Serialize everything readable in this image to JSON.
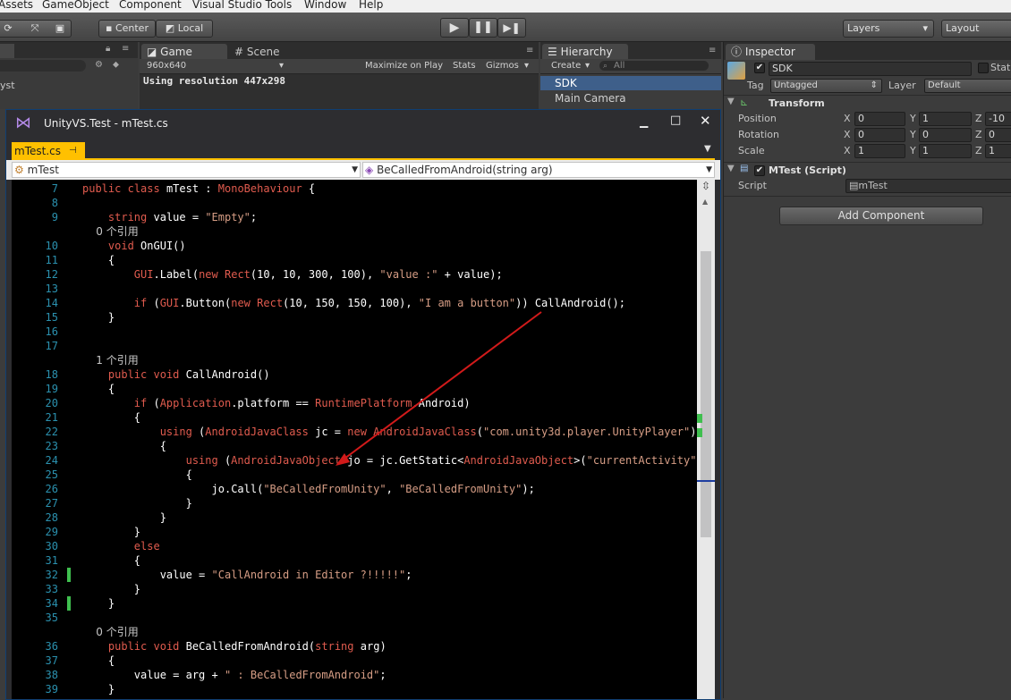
{
  "menu": {
    "items": [
      "Assets",
      "GameObject",
      "Component",
      "Visual Studio Tools",
      "Window",
      "Help"
    ]
  },
  "toolbar": {
    "center_label": "Center",
    "local_label": "Local",
    "layers_label": "Layers",
    "layout_label": "Layout"
  },
  "left_panel": {
    "partial_text": "yst"
  },
  "game_panel": {
    "tab_game": "Game",
    "tab_scene": "Scene",
    "resolution_select": "960x640",
    "maximize_label": "Maximize on Play",
    "stats_label": "Stats",
    "gizmos_label": "Gizmos",
    "resolution_text": "Using resolution 447x298"
  },
  "hierarchy": {
    "tab": "Hierarchy",
    "create_label": "Create",
    "search_placeholder": "All",
    "items": [
      "SDK",
      "Main Camera"
    ]
  },
  "inspector": {
    "tab": "Inspector",
    "object_name": "SDK",
    "static_label": "Stat",
    "tag_label": "Tag",
    "tag_value": "Untagged",
    "layer_label": "Layer",
    "layer_value": "Default",
    "transform_title": "Transform",
    "position_label": "Position",
    "rotation_label": "Rotation",
    "scale_label": "Scale",
    "position": {
      "x": "0",
      "y": "1",
      "z": "-10"
    },
    "rotation": {
      "x": "0",
      "y": "0",
      "z": "0"
    },
    "scale": {
      "x": "1",
      "y": "1",
      "z": "1"
    },
    "axis_x": "X",
    "axis_y": "Y",
    "axis_z": "Z",
    "script_component_title": "MTest (Script)",
    "script_label": "Script",
    "script_value": "mTest",
    "add_component_label": "Add Component"
  },
  "vs_window": {
    "title": "UnityVS.Test - mTest.cs",
    "file_tab": "mTest.cs",
    "pin_symbol": "⊣",
    "nav_class": "mTest",
    "nav_member": "BeCalledFromAndroid(string arg)"
  },
  "code_lines": [
    {
      "n": "7",
      "text": "public class mTest : MonoBehaviour {"
    },
    {
      "n": "8",
      "text": ""
    },
    {
      "n": "9",
      "text": "    string value = \"Empty\";"
    },
    {
      "n": "",
      "text": "    0 个引用"
    },
    {
      "n": "10",
      "text": "    void OnGUI()"
    },
    {
      "n": "11",
      "text": "    {"
    },
    {
      "n": "12",
      "text": "        GUI.Label(new Rect(10, 10, 300, 100), \"value :\" + value);"
    },
    {
      "n": "13",
      "text": ""
    },
    {
      "n": "14",
      "text": "        if (GUI.Button(new Rect(10, 150, 150, 100), \"I am a button\")) CallAndroid();"
    },
    {
      "n": "15",
      "text": "    }"
    },
    {
      "n": "16",
      "text": ""
    },
    {
      "n": "17",
      "text": ""
    },
    {
      "n": "",
      "text": "    1 个引用"
    },
    {
      "n": "18",
      "text": "    public void CallAndroid()"
    },
    {
      "n": "19",
      "text": "    {"
    },
    {
      "n": "20",
      "text": "        if (Application.platform == RuntimePlatform.Android)"
    },
    {
      "n": "21",
      "text": "        {"
    },
    {
      "n": "22",
      "text": "            using (AndroidJavaClass jc = new AndroidJavaClass(\"com.unity3d.player.UnityPlayer\"))"
    },
    {
      "n": "23",
      "text": "            {"
    },
    {
      "n": "24",
      "text": "                using (AndroidJavaObject jo = jc.GetStatic<AndroidJavaObject>(\"currentActivity\"))"
    },
    {
      "n": "25",
      "text": "                {"
    },
    {
      "n": "26",
      "text": "                    jo.Call(\"BeCalledFromUnity\", \"BeCalledFromUnity\");"
    },
    {
      "n": "27",
      "text": "                }"
    },
    {
      "n": "28",
      "text": "            }"
    },
    {
      "n": "29",
      "text": "        }"
    },
    {
      "n": "30",
      "text": "        else"
    },
    {
      "n": "31",
      "text": "        {"
    },
    {
      "n": "32",
      "text": "            value = \"CallAndroid in Editor ?!!!!!\";"
    },
    {
      "n": "33",
      "text": "        }"
    },
    {
      "n": "34",
      "text": "    }"
    },
    {
      "n": "35",
      "text": ""
    },
    {
      "n": "",
      "text": "    0 个引用"
    },
    {
      "n": "36",
      "text": "    public void BeCalledFromAndroid(string arg)"
    },
    {
      "n": "37",
      "text": "    {"
    },
    {
      "n": "38",
      "text": "        value = arg + \" : BeCalledFromAndroid\";"
    },
    {
      "n": "39",
      "text": "    }"
    }
  ],
  "colors": {
    "keyword": "#e05b4e",
    "string": "#d69d85",
    "line_number": "#2b91af",
    "change_marker": "#3fbf4f",
    "selection": "#3e5f8a",
    "annotation_arrow": "#d11a1a"
  }
}
